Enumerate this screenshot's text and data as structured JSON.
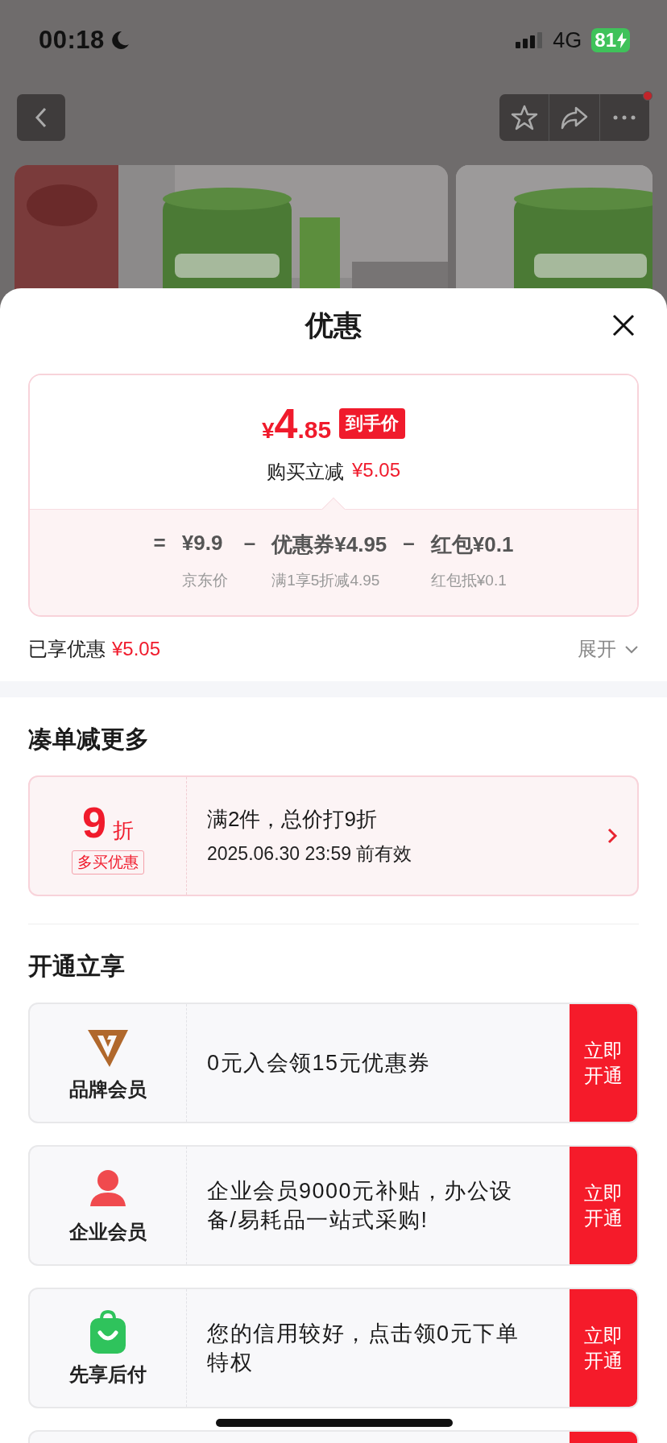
{
  "status_bar": {
    "time": "00:18",
    "network": "4G",
    "battery": "81",
    "charging": true,
    "do_not_disturb": true
  },
  "nav": {
    "notification": true
  },
  "sheet": {
    "title": "优惠",
    "price_card": {
      "currency": "¥",
      "integer": "4",
      "decimal": ".85",
      "badge": "到手价",
      "saving_label": "购买立减",
      "saving_amount": "¥5.05",
      "equals": "=",
      "terms": [
        {
          "amount": "¥9.9",
          "caption": "京东价"
        },
        {
          "operator": "–",
          "amount": "优惠券¥4.95",
          "caption": "满1享5折减4.95"
        },
        {
          "operator": "–",
          "amount": "红包¥0.1",
          "caption": "红包抵¥0.1"
        }
      ]
    },
    "summary": {
      "label": "已享优惠",
      "amount": "¥5.05",
      "toggle": "展开",
      "expanded": false
    },
    "sections": [
      {
        "kind": "discount",
        "heading": "凑单减更多",
        "rate": "9",
        "unit": "折",
        "tag": "多买优惠",
        "title": "满2件，总价打9折",
        "validity": "2025.06.30 23:59 前有效"
      },
      {
        "kind": "membership",
        "heading": "开通立享",
        "items": [
          {
            "kind": "brand",
            "name": "品牌会员",
            "text": "0元入会领15元优惠券",
            "button": "立即开通"
          },
          {
            "kind": "person",
            "name": "企业会员",
            "text": "企业会员9000元补贴，办公设备/易耗品一站式采购!",
            "button": "立即开通"
          },
          {
            "kind": "bag",
            "name": "先享后付",
            "text": "您的信用较好，点击领0元下单特权",
            "button": "立即开通"
          }
        ]
      }
    ]
  }
}
